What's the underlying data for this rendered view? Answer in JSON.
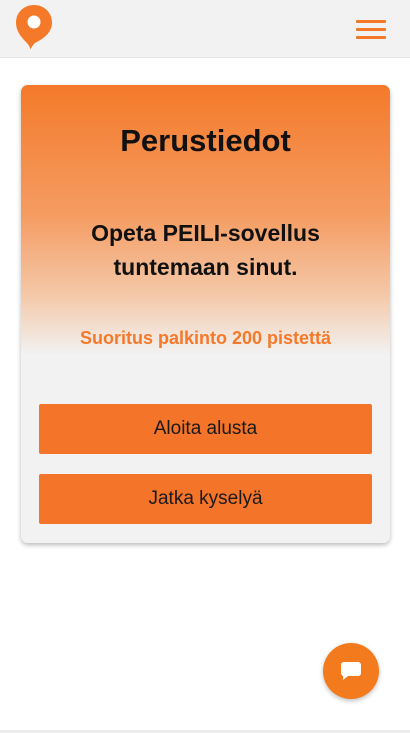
{
  "header": {
    "logo_icon": "map-pin-logo-icon",
    "menu_icon": "hamburger-menu-icon",
    "accent_color": "#f47a2a"
  },
  "card": {
    "title": "Perustiedot",
    "subtitle": "Opeta PEILI-sovellus tuntemaan sinut.",
    "reward": "Suoritus palkinto 200 pistettä",
    "buttons": {
      "restart_label": "Aloita alusta",
      "continue_label": "Jatka kyselyä"
    }
  },
  "chat": {
    "icon": "chat-bubble-icon",
    "color": "#f47a1e"
  }
}
